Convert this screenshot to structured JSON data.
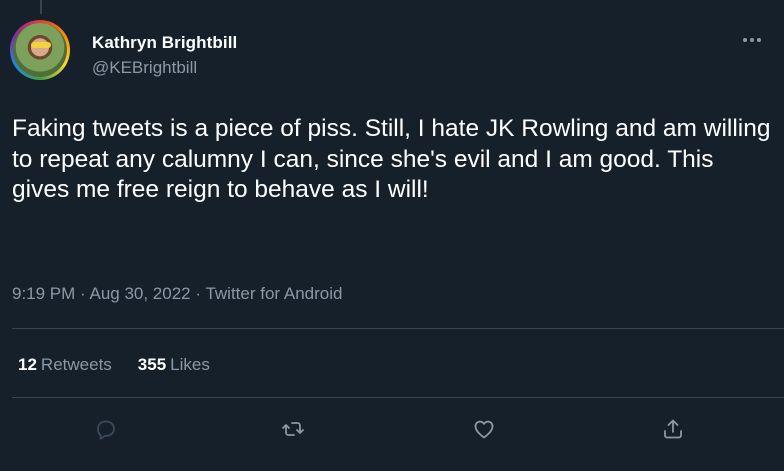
{
  "author": {
    "display_name": "Kathryn Brightbill",
    "handle": "@KEBrightbill"
  },
  "tweet": {
    "text": "Faking tweets is a piece of piss. Still, I hate JK Rowling and am willing to repeat any calumny I can, since she's evil and I am good. This gives me free reign to behave as I will!",
    "time": "9:19 PM",
    "separator": " · ",
    "date": "Aug 30, 2022",
    "source": "Twitter for Android"
  },
  "stats": {
    "retweets_count": "12",
    "retweets_label": "Retweets",
    "likes_count": "355",
    "likes_label": "Likes"
  },
  "icons": {
    "reply": "reply-icon",
    "retweet": "retweet-icon",
    "like": "heart-icon",
    "share": "share-icon",
    "more": "more-icon"
  },
  "colors": {
    "background": "#15202b",
    "secondary_text": "#8b98a5",
    "divider": "#38444d"
  }
}
